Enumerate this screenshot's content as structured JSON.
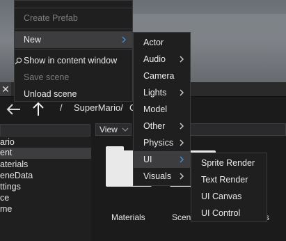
{
  "main_menu": {
    "items": [
      {
        "label": "Create Prefab",
        "enabled": false
      },
      {
        "label": "New",
        "enabled": true,
        "submenu": true,
        "highlighted": true
      },
      {
        "label": "Show in content window",
        "enabled": true,
        "icon": "search-icon"
      },
      {
        "label": "Save scene",
        "enabled": false
      },
      {
        "label": "Unload scene",
        "enabled": true
      }
    ]
  },
  "new_menu": {
    "items": [
      {
        "label": "Actor"
      },
      {
        "label": "Audio",
        "submenu": true
      },
      {
        "label": "Camera"
      },
      {
        "label": "Lights",
        "submenu": true
      },
      {
        "label": "Model"
      },
      {
        "label": "Other",
        "submenu": true
      },
      {
        "label": "Physics",
        "submenu": true
      },
      {
        "label": "UI",
        "submenu": true,
        "highlighted": true
      },
      {
        "label": "Visuals",
        "submenu": true
      }
    ]
  },
  "ui_menu": {
    "items": [
      {
        "label": "Sprite Render"
      },
      {
        "label": "Text Render"
      },
      {
        "label": "UI Canvas"
      },
      {
        "label": "UI Control"
      }
    ]
  },
  "content_browser": {
    "path_separator": "/",
    "path_folder": "SuperMario/",
    "path_trailing": "C",
    "view_label": "View",
    "tree": [
      "ario",
      "ent",
      "aterials",
      "eneData",
      "ttings",
      "ce",
      "me"
    ],
    "folders": [
      "Materials",
      "Scen",
      "s"
    ]
  },
  "colors": {
    "menu_bg": "#1f1f20",
    "highlight": "#3d3d40",
    "disabled_text": "#7c7c7e",
    "chevron_blue": "#4a90d9"
  }
}
